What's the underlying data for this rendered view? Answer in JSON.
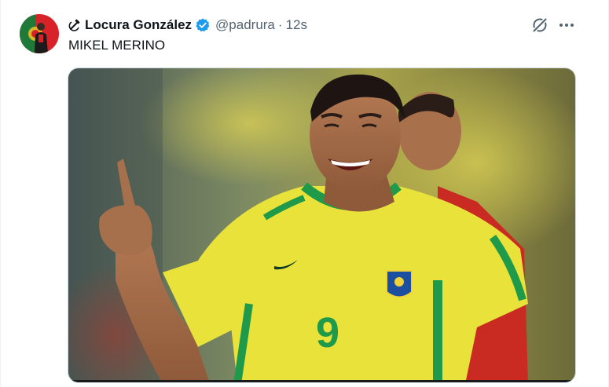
{
  "tweet": {
    "author": {
      "display_name": "Locura González",
      "handle": "@padrura",
      "verified": true,
      "avatar_icon": "portugal-flag-avatar",
      "name_emoji_icon": "hammer-sickle-icon"
    },
    "separator": "·",
    "timestamp": "12s",
    "text": "MIKEL MERINO",
    "media": {
      "type": "photo",
      "jersey_number": "9"
    },
    "actions": {
      "grok_icon": "grok-icon",
      "more_icon": "more-icon"
    }
  },
  "colors": {
    "text_primary": "#0f1419",
    "text_secondary": "#536471",
    "verified_blue": "#1d9bf0",
    "jersey_yellow": "#e8e23a",
    "jersey_green": "#1f9a4a"
  }
}
